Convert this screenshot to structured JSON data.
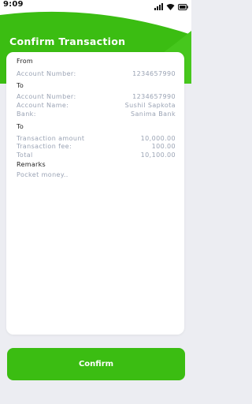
{
  "status_bar": {
    "time": "9:09",
    "icons": [
      "signal-icon",
      "wifi-icon",
      "battery-icon"
    ]
  },
  "header": {
    "title": "Confirm Transaction"
  },
  "from": {
    "section_label": "From",
    "account_number_label": "Account Number:",
    "account_number_value": "1234657990"
  },
  "to_account": {
    "section_label": "To",
    "account_number_label": "Account Number:",
    "account_number_value": "1234657990",
    "account_name_label": "Account Name:",
    "account_name_value": "Sushil Sapkota",
    "bank_label": "Bank:",
    "bank_value": "Sanima Bank"
  },
  "amounts": {
    "section_label": "To",
    "transaction_amount_label": "Transaction amount",
    "transaction_amount_value": "10,000.00",
    "transaction_fee_label": "Transaction fee:",
    "transaction_fee_value": "100.00",
    "total_label": "Total",
    "total_value": "10,100.00"
  },
  "remarks": {
    "section_label": "Remarks",
    "text": "Pocket money.."
  },
  "actions": {
    "confirm_label": "Confirm"
  },
  "colors": {
    "accent_green": "#3bbd12",
    "background": "#ecedf2",
    "muted_text": "#9aa3b4"
  }
}
